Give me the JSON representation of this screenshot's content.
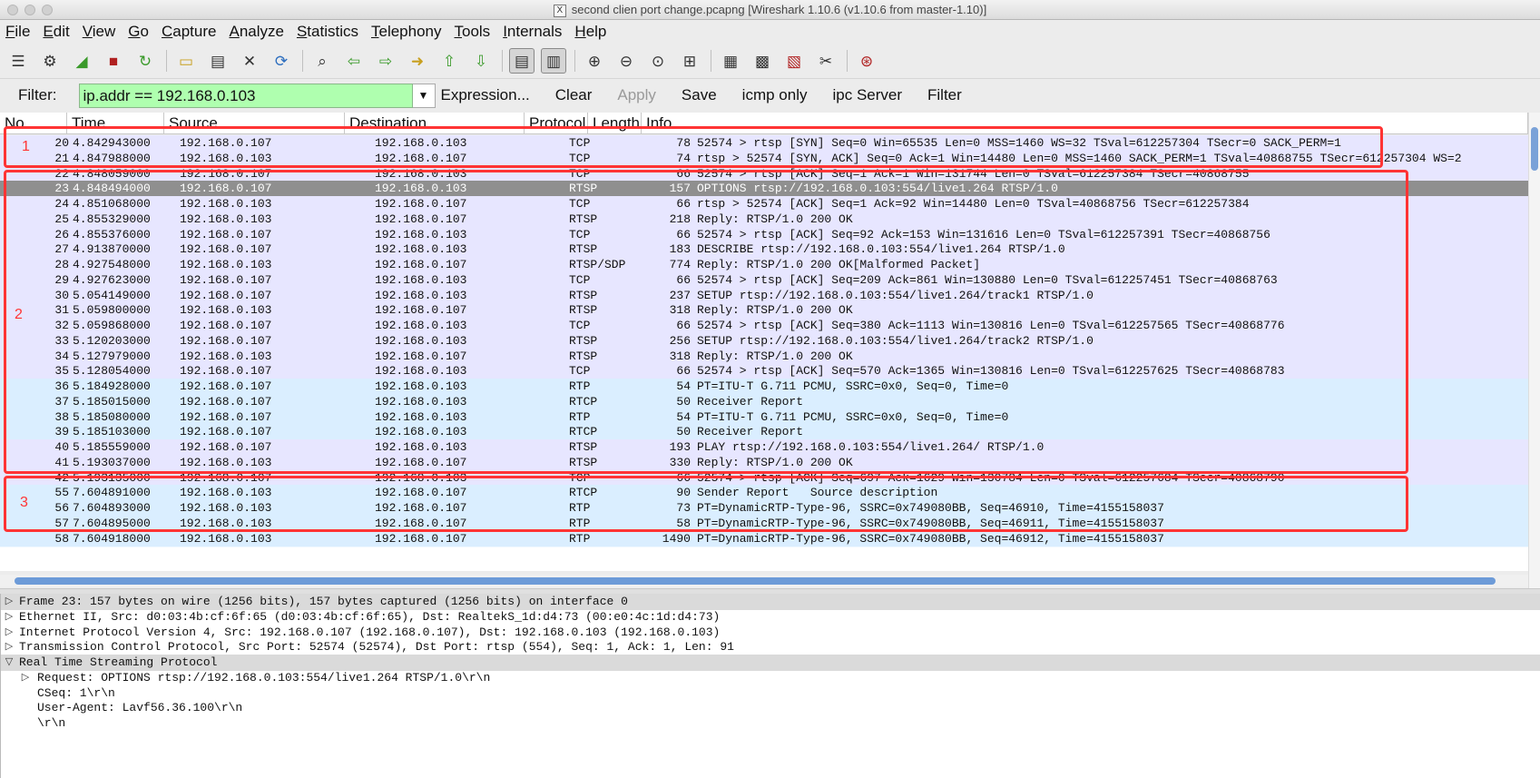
{
  "window": {
    "title": "second clien port change.pcapng   [Wireshark 1.10.6  (v1.10.6 from master-1.10)]",
    "x_glyph": "X"
  },
  "menu": [
    "File",
    "Edit",
    "View",
    "Go",
    "Capture",
    "Analyze",
    "Statistics",
    "Telephony",
    "Tools",
    "Internals",
    "Help"
  ],
  "toolbar": {
    "icons": [
      {
        "name": "interfaces-icon",
        "glyph": "☰",
        "color": "k"
      },
      {
        "name": "options-icon",
        "glyph": "⚙",
        "color": "k"
      },
      {
        "name": "start-capture-icon",
        "glyph": "◢",
        "color": "g"
      },
      {
        "name": "stop-capture-icon",
        "glyph": "■",
        "color": "r"
      },
      {
        "name": "restart-capture-icon",
        "glyph": "↻",
        "color": "g"
      },
      {
        "sep": true
      },
      {
        "name": "open-icon",
        "glyph": "▭",
        "color": "y"
      },
      {
        "name": "save-icon",
        "glyph": "▤",
        "color": "k"
      },
      {
        "name": "close-icon",
        "glyph": "✕",
        "color": "k"
      },
      {
        "name": "reload-icon",
        "glyph": "⟳",
        "color": "b"
      },
      {
        "sep": true
      },
      {
        "name": "find-icon",
        "glyph": "⌕",
        "color": "k"
      },
      {
        "name": "back-icon",
        "glyph": "⇦",
        "color": "g"
      },
      {
        "name": "forward-icon",
        "glyph": "⇨",
        "color": "g"
      },
      {
        "name": "goto-icon",
        "glyph": "➜",
        "color": "y"
      },
      {
        "name": "first-icon",
        "glyph": "⇧",
        "color": "g"
      },
      {
        "name": "last-icon",
        "glyph": "⇩",
        "color": "g"
      },
      {
        "sep": true
      },
      {
        "name": "colorize-icon",
        "glyph": "▤",
        "color": "k",
        "active": true
      },
      {
        "name": "autoscroll-icon",
        "glyph": "▥",
        "color": "k",
        "active": true
      },
      {
        "sep": true
      },
      {
        "name": "zoom-in-icon",
        "glyph": "⊕",
        "color": "k"
      },
      {
        "name": "zoom-out-icon",
        "glyph": "⊖",
        "color": "k"
      },
      {
        "name": "zoom-normal-icon",
        "glyph": "⊙",
        "color": "k"
      },
      {
        "name": "resize-columns-icon",
        "glyph": "⊞",
        "color": "k"
      },
      {
        "sep": true
      },
      {
        "name": "capture-filters-icon",
        "glyph": "▦",
        "color": "k"
      },
      {
        "name": "display-filters-icon",
        "glyph": "▩",
        "color": "k"
      },
      {
        "name": "coloring-rules-icon",
        "glyph": "▧",
        "color": "r"
      },
      {
        "name": "preferences-icon",
        "glyph": "✂",
        "color": "k"
      },
      {
        "sep": true
      },
      {
        "name": "help-icon",
        "glyph": "⊛",
        "color": "r"
      }
    ]
  },
  "filter": {
    "label": "Filter:",
    "value": "ip.addr == 192.168.0.103",
    "buttons": [
      {
        "name": "expression-button",
        "label": "Expression...",
        "disabled": false
      },
      {
        "name": "clear-button",
        "label": "Clear",
        "disabled": false
      },
      {
        "name": "apply-button",
        "label": "Apply",
        "disabled": true
      },
      {
        "name": "save-filter-button",
        "label": "Save",
        "disabled": false
      },
      {
        "name": "icmp-only-button",
        "label": "icmp only",
        "disabled": false
      },
      {
        "name": "ipc-server-button",
        "label": "ipc Server",
        "disabled": false
      },
      {
        "name": "filter-button",
        "label": "Filter",
        "disabled": false
      }
    ]
  },
  "columns": [
    "No.",
    "Time",
    "Source",
    "Destination",
    "Protocol",
    "Length",
    "Info"
  ],
  "colors": {
    "tcp": "#e7e6ff",
    "udp": "#daeeff",
    "selected": "#8f8f8f",
    "box": "#ff3434"
  },
  "packets": [
    {
      "no": "20",
      "time": "4.842943000",
      "src": "192.168.0.107",
      "dst": "192.168.0.103",
      "proto": "TCP",
      "len": "78",
      "info": "52574 > rtsp [SYN] Seq=0 Win=65535 Len=0 MSS=1460 WS=32 TSval=612257304 TSecr=0 SACK_PERM=1",
      "kind": "tcp"
    },
    {
      "no": "21",
      "time": "4.847988000",
      "src": "192.168.0.103",
      "dst": "192.168.0.107",
      "proto": "TCP",
      "len": "74",
      "info": "rtsp > 52574 [SYN, ACK] Seq=0 Ack=1 Win=14480 Len=0 MSS=1460 SACK_PERM=1 TSval=40868755 TSecr=612257304 WS=2",
      "kind": "tcp"
    },
    {
      "no": "22",
      "time": "4.848059000",
      "src": "192.168.0.107",
      "dst": "192.168.0.103",
      "proto": "TCP",
      "len": "66",
      "info": "52574 > rtsp [ACK] Seq=1 Ack=1 Win=131744 Len=0 TSval=612257384 TSecr=40868755",
      "kind": "tcp"
    },
    {
      "no": "23",
      "time": "4.848494000",
      "src": "192.168.0.107",
      "dst": "192.168.0.103",
      "proto": "RTSP",
      "len": "157",
      "info": "OPTIONS rtsp://192.168.0.103:554/live1.264 RTSP/1.0",
      "kind": "selected"
    },
    {
      "no": "24",
      "time": "4.851068000",
      "src": "192.168.0.103",
      "dst": "192.168.0.107",
      "proto": "TCP",
      "len": "66",
      "info": "rtsp > 52574 [ACK] Seq=1 Ack=92 Win=14480 Len=0 TSval=40868756 TSecr=612257384",
      "kind": "tcp"
    },
    {
      "no": "25",
      "time": "4.855329000",
      "src": "192.168.0.103",
      "dst": "192.168.0.107",
      "proto": "RTSP",
      "len": "218",
      "info": "Reply: RTSP/1.0 200 OK",
      "kind": "tcp"
    },
    {
      "no": "26",
      "time": "4.855376000",
      "src": "192.168.0.107",
      "dst": "192.168.0.103",
      "proto": "TCP",
      "len": "66",
      "info": "52574 > rtsp [ACK] Seq=92 Ack=153 Win=131616 Len=0 TSval=612257391 TSecr=40868756",
      "kind": "tcp"
    },
    {
      "no": "27",
      "time": "4.913870000",
      "src": "192.168.0.107",
      "dst": "192.168.0.103",
      "proto": "RTSP",
      "len": "183",
      "info": "DESCRIBE rtsp://192.168.0.103:554/live1.264 RTSP/1.0",
      "kind": "tcp"
    },
    {
      "no": "28",
      "time": "4.927548000",
      "src": "192.168.0.103",
      "dst": "192.168.0.107",
      "proto": "RTSP/SDP",
      "len": "774",
      "info": "Reply: RTSP/1.0 200 OK[Malformed Packet]",
      "kind": "tcp"
    },
    {
      "no": "29",
      "time": "4.927623000",
      "src": "192.168.0.107",
      "dst": "192.168.0.103",
      "proto": "TCP",
      "len": "66",
      "info": "52574 > rtsp [ACK] Seq=209 Ack=861 Win=130880 Len=0 TSval=612257451 TSecr=40868763",
      "kind": "tcp"
    },
    {
      "no": "30",
      "time": "5.054149000",
      "src": "192.168.0.107",
      "dst": "192.168.0.103",
      "proto": "RTSP",
      "len": "237",
      "info": "SETUP rtsp://192.168.0.103:554/live1.264/track1 RTSP/1.0",
      "kind": "tcp"
    },
    {
      "no": "31",
      "time": "5.059800000",
      "src": "192.168.0.103",
      "dst": "192.168.0.107",
      "proto": "RTSP",
      "len": "318",
      "info": "Reply: RTSP/1.0 200 OK",
      "kind": "tcp"
    },
    {
      "no": "32",
      "time": "5.059868000",
      "src": "192.168.0.107",
      "dst": "192.168.0.103",
      "proto": "TCP",
      "len": "66",
      "info": "52574 > rtsp [ACK] Seq=380 Ack=1113 Win=130816 Len=0 TSval=612257565 TSecr=40868776",
      "kind": "tcp"
    },
    {
      "no": "33",
      "time": "5.120203000",
      "src": "192.168.0.107",
      "dst": "192.168.0.103",
      "proto": "RTSP",
      "len": "256",
      "info": "SETUP rtsp://192.168.0.103:554/live1.264/track2 RTSP/1.0",
      "kind": "tcp"
    },
    {
      "no": "34",
      "time": "5.127979000",
      "src": "192.168.0.103",
      "dst": "192.168.0.107",
      "proto": "RTSP",
      "len": "318",
      "info": "Reply: RTSP/1.0 200 OK",
      "kind": "tcp"
    },
    {
      "no": "35",
      "time": "5.128054000",
      "src": "192.168.0.107",
      "dst": "192.168.0.103",
      "proto": "TCP",
      "len": "66",
      "info": "52574 > rtsp [ACK] Seq=570 Ack=1365 Win=130816 Len=0 TSval=612257625 TSecr=40868783",
      "kind": "tcp"
    },
    {
      "no": "36",
      "time": "5.184928000",
      "src": "192.168.0.107",
      "dst": "192.168.0.103",
      "proto": "RTP",
      "len": "54",
      "info": "PT=ITU-T G.711 PCMU, SSRC=0x0, Seq=0, Time=0",
      "kind": "udp"
    },
    {
      "no": "37",
      "time": "5.185015000",
      "src": "192.168.0.107",
      "dst": "192.168.0.103",
      "proto": "RTCP",
      "len": "50",
      "info": "Receiver Report",
      "kind": "udp"
    },
    {
      "no": "38",
      "time": "5.185080000",
      "src": "192.168.0.107",
      "dst": "192.168.0.103",
      "proto": "RTP",
      "len": "54",
      "info": "PT=ITU-T G.711 PCMU, SSRC=0x0, Seq=0, Time=0",
      "kind": "udp"
    },
    {
      "no": "39",
      "time": "5.185103000",
      "src": "192.168.0.107",
      "dst": "192.168.0.103",
      "proto": "RTCP",
      "len": "50",
      "info": "Receiver Report",
      "kind": "udp"
    },
    {
      "no": "40",
      "time": "5.185559000",
      "src": "192.168.0.107",
      "dst": "192.168.0.103",
      "proto": "RTSP",
      "len": "193",
      "info": "PLAY rtsp://192.168.0.103:554/live1.264/ RTSP/1.0",
      "kind": "tcp"
    },
    {
      "no": "41",
      "time": "5.193037000",
      "src": "192.168.0.103",
      "dst": "192.168.0.107",
      "proto": "RTSP",
      "len": "330",
      "info": "Reply: RTSP/1.0 200 OK",
      "kind": "tcp"
    },
    {
      "no": "42",
      "time": "5.193135000",
      "src": "192.168.0.107",
      "dst": "192.168.0.103",
      "proto": "TCP",
      "len": "66",
      "info": "52574 > rtsp [ACK] Seq=697 Ack=1629 Win=130784 Len=0 TSval=612257684 TSecr=40868790",
      "kind": "tcp"
    },
    {
      "no": "55",
      "time": "7.604891000",
      "src": "192.168.0.103",
      "dst": "192.168.0.107",
      "proto": "RTCP",
      "len": "90",
      "info": "Sender Report   Source description",
      "kind": "udp"
    },
    {
      "no": "56",
      "time": "7.604893000",
      "src": "192.168.0.103",
      "dst": "192.168.0.107",
      "proto": "RTP",
      "len": "73",
      "info": "PT=DynamicRTP-Type-96, SSRC=0x749080BB, Seq=46910, Time=4155158037",
      "kind": "udp"
    },
    {
      "no": "57",
      "time": "7.604895000",
      "src": "192.168.0.103",
      "dst": "192.168.0.107",
      "proto": "RTP",
      "len": "58",
      "info": "PT=DynamicRTP-Type-96, SSRC=0x749080BB, Seq=46911, Time=4155158037",
      "kind": "udp"
    },
    {
      "no": "58",
      "time": "7.604918000",
      "src": "192.168.0.103",
      "dst": "192.168.0.107",
      "proto": "RTP",
      "len": "1490",
      "info": "PT=DynamicRTP-Type-96, SSRC=0x749080BB, Seq=46912, Time=4155158037",
      "kind": "udp"
    }
  ],
  "annotations": [
    "1",
    "2",
    "3"
  ],
  "details": [
    {
      "text": "Frame 23: 157 bytes on wire (1256 bits), 157 bytes captured (1256 bits) on interface 0",
      "indent": 0,
      "state": "collapsed",
      "header": true
    },
    {
      "text": "Ethernet II, Src: d0:03:4b:cf:6f:65 (d0:03:4b:cf:6f:65), Dst: RealtekS_1d:d4:73 (00:e0:4c:1d:d4:73)",
      "indent": 0,
      "state": "collapsed"
    },
    {
      "text": "Internet Protocol Version 4, Src: 192.168.0.107 (192.168.0.107), Dst: 192.168.0.103 (192.168.0.103)",
      "indent": 0,
      "state": "collapsed"
    },
    {
      "text": "Transmission Control Protocol, Src Port: 52574 (52574), Dst Port: rtsp (554), Seq: 1, Ack: 1, Len: 91",
      "indent": 0,
      "state": "collapsed"
    },
    {
      "text": "Real Time Streaming Protocol",
      "indent": 0,
      "state": "expanded",
      "header": true
    },
    {
      "text": "Request: OPTIONS rtsp://192.168.0.103:554/live1.264 RTSP/1.0\\r\\n",
      "indent": 1,
      "state": "collapsed"
    },
    {
      "text": "CSeq: 1\\r\\n",
      "indent": 1,
      "state": "leaf"
    },
    {
      "text": "User-Agent: Lavf56.36.100\\r\\n",
      "indent": 1,
      "state": "leaf"
    },
    {
      "text": "\\r\\n",
      "indent": 1,
      "state": "leaf"
    }
  ]
}
